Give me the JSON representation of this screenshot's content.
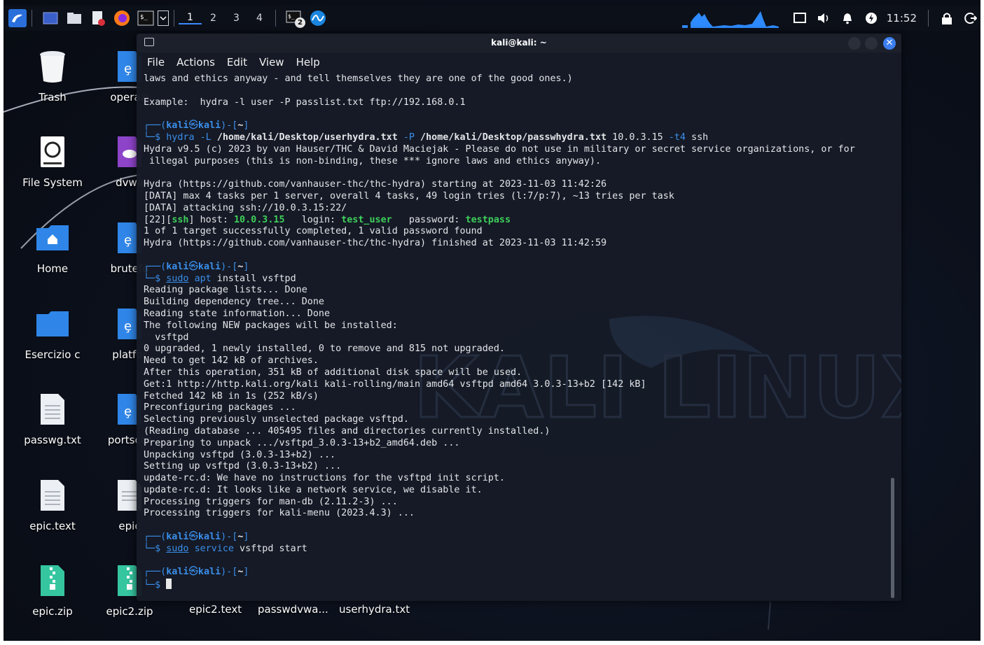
{
  "taskbar": {
    "workspaces": [
      "1",
      "2",
      "3",
      "4"
    ],
    "badge": "2",
    "clock": "11:52"
  },
  "desktop_icons": [
    {
      "label": "Trash",
      "icon": "trash-icon"
    },
    {
      "label": "File System",
      "icon": "drive-icon"
    },
    {
      "label": "Home",
      "icon": "home-folder-icon"
    },
    {
      "label": "Esercizio c",
      "icon": "folder-icon"
    },
    {
      "label": "passwg.txt",
      "icon": "text-file-icon"
    },
    {
      "label": "epic.text",
      "icon": "text-file-icon"
    },
    {
      "label": "epic.zip",
      "icon": "zip-file-icon"
    }
  ],
  "desktop_icons_col2": [
    {
      "label": "operazi",
      "icon": "python-file-icon"
    },
    {
      "label": "dvwa",
      "icon": "php-file-icon"
    },
    {
      "label": "brutefo",
      "icon": "python-file-icon"
    },
    {
      "label": "platfor",
      "icon": "python-file-icon"
    },
    {
      "label": "portscar",
      "icon": "python-file-icon"
    },
    {
      "label": "epic",
      "icon": "text-file-icon"
    },
    {
      "label": "epic2.zip",
      "icon": "zip-file-icon"
    }
  ],
  "bottom_labels": [
    "epic2.text",
    "passwdvwa...",
    "userhydra.txt"
  ],
  "terminal": {
    "title": "kali@kali: ~",
    "menu": [
      "File",
      "Actions",
      "Edit",
      "View",
      "Help"
    ],
    "lines": [
      "laws and ethics anyway - and tell themselves they are one of the good ones.)",
      "",
      "Example:  hydra -l user -P passlist.txt ftp://192.168.0.1",
      "",
      "PROMPT",
      "CMD_HYDRA",
      "Hydra v9.5 (c) 2023 by van Hauser/THC & David Maciejak - Please do not use in military or secret service organizations, or for",
      " illegal purposes (this is non-binding, these *** ignore laws and ethics anyway).",
      "",
      "Hydra (https://github.com/vanhauser-thc/thc-hydra) starting at 2023-11-03 11:42:26",
      "[DATA] max 4 tasks per 1 server, overall 4 tasks, 49 login tries (l:7/p:7), ~13 tries per task",
      "[DATA] attacking ssh://10.0.3.15:22/",
      "RESULT",
      "1 of 1 target successfully completed, 1 valid password found",
      "Hydra (https://github.com/vanhauser-thc/thc-hydra) finished at 2023-11-03 11:42:59",
      "",
      "PROMPT",
      "CMD_APT",
      "Reading package lists... Done",
      "Building dependency tree... Done",
      "Reading state information... Done",
      "The following NEW packages will be installed:",
      "  vsftpd",
      "0 upgraded, 1 newly installed, 0 to remove and 815 not upgraded.",
      "Need to get 142 kB of archives.",
      "After this operation, 351 kB of additional disk space will be used.",
      "Get:1 http://http.kali.org/kali kali-rolling/main amd64 vsftpd amd64 3.0.3-13+b2 [142 kB]",
      "Fetched 142 kB in 1s (252 kB/s)",
      "Preconfiguring packages ...",
      "Selecting previously unselected package vsftpd.",
      "(Reading database ... 405495 files and directories currently installed.)",
      "Preparing to unpack .../vsftpd_3.0.3-13+b2_amd64.deb ...",
      "Unpacking vsftpd (3.0.3-13+b2) ...",
      "Setting up vsftpd (3.0.3-13+b2) ...",
      "update-rc.d: We have no instructions for the vsftpd init script.",
      "update-rc.d: It looks like a network service, we disable it.",
      "Processing triggers for man-db (2.11.2-3) ...",
      "Processing triggers for kali-menu (2023.4.3) ...",
      "",
      "PROMPT",
      "CMD_SERVICE",
      "",
      "PROMPT",
      "CURSOR"
    ],
    "prompt": {
      "open": "┌──(",
      "user": "kali",
      "at": "㉿",
      "host": "kali",
      "close": ")-[",
      "dir": "~",
      "end": "]"
    },
    "cmd_hydra": {
      "prog": "hydra",
      "flag_L": "-L",
      "file1": "/home/kali/Desktop/userhydra.txt",
      "flag_P": "-P",
      "file2": "/home/kali/Desktop/passwhydra.txt",
      "target": "10.0.3.15",
      "flag_t": "-t4",
      "service": "ssh"
    },
    "result": {
      "prefix": "[22][",
      "svc": "ssh",
      "mid": "] host: ",
      "host": "10.0.3.15",
      "login_label": "   login: ",
      "login": "test_user",
      "pass_label": "   password: ",
      "password": "testpass"
    },
    "cmd_apt": {
      "sudo": "sudo",
      "prog": "apt",
      "args": " install vsftpd"
    },
    "cmd_service": {
      "sudo": "sudo",
      "prog": "service",
      "args": " vsftpd start"
    }
  }
}
